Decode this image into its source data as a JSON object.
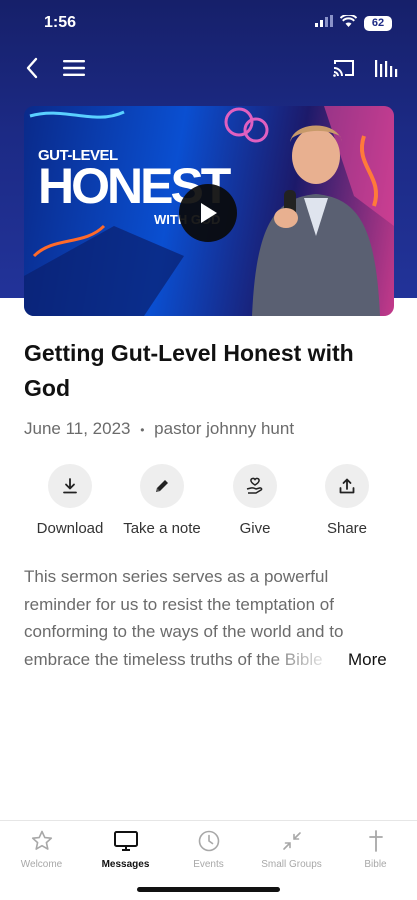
{
  "status_bar": {
    "time": "1:56",
    "battery": "62"
  },
  "nav": {
    "back_icon": "chevron-left-icon",
    "menu_icon": "hamburger-icon",
    "cast_icon": "cast-icon",
    "audio_icon": "audio-bars-icon"
  },
  "video": {
    "thumb_small": "GUT-LEVEL",
    "thumb_big": "HONEST",
    "thumb_with": "WITH GOD",
    "play_icon": "play-icon"
  },
  "sermon": {
    "title": "Getting Gut-Level Honest with God",
    "date": "June 11, 2023",
    "separator": "•",
    "speaker": "pastor johnny hunt"
  },
  "actions": [
    {
      "label": "Download",
      "icon": "download-icon"
    },
    {
      "label": "Take a note",
      "icon": "pencil-icon"
    },
    {
      "label": "Give",
      "icon": "give-hand-icon"
    },
    {
      "label": "Share",
      "icon": "share-icon"
    }
  ],
  "description": {
    "lines": [
      "This sermon series serves as a powerful",
      "reminder for us to resist the temptation of",
      "conforming to the ways of the world and to",
      "embrace the timeless truths of the Bible"
    ],
    "more_label": "More"
  },
  "tabs": [
    {
      "label": "Welcome",
      "icon": "star-icon",
      "active": false
    },
    {
      "label": "Messages",
      "icon": "tv-icon",
      "active": true
    },
    {
      "label": "Events",
      "icon": "clock-icon",
      "active": false
    },
    {
      "label": "Small Groups",
      "icon": "arrows-collapse-icon",
      "active": false
    },
    {
      "label": "Bible",
      "icon": "cross-icon",
      "active": false
    }
  ],
  "colors": {
    "hero": "#1c2a85",
    "text_dark": "#111111",
    "text_muted": "#6b6b6b",
    "tab_inactive": "#a8a8a8"
  }
}
